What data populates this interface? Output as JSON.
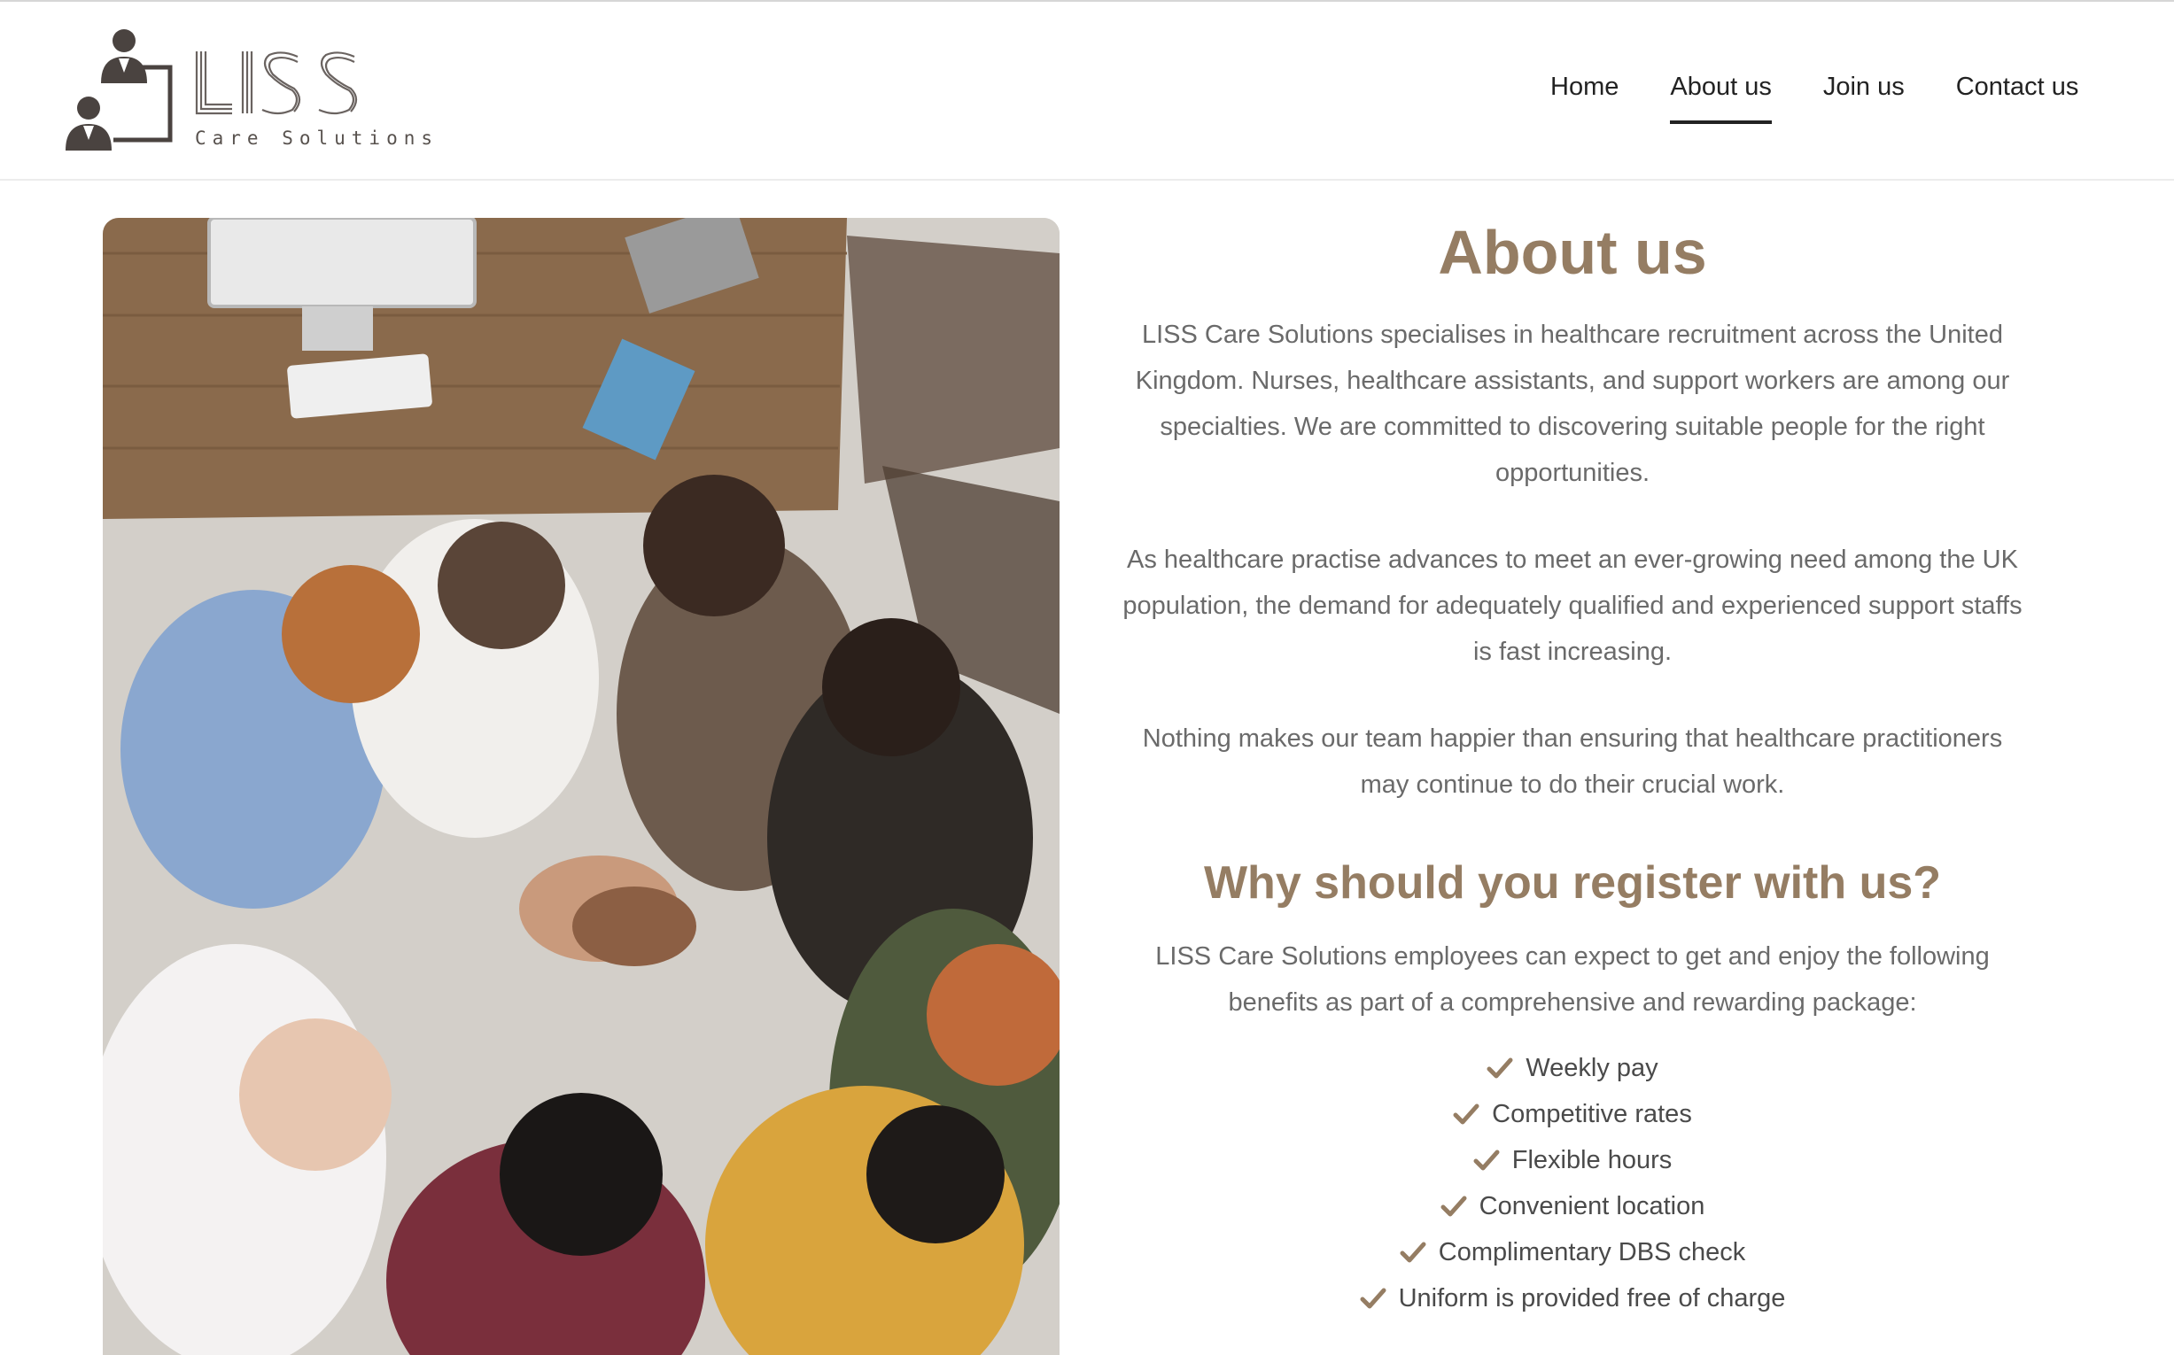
{
  "brand": {
    "name": "LISS",
    "tagline": "Care Solutions",
    "accent_color": "#957d63"
  },
  "nav": {
    "items": [
      {
        "label": "Home",
        "active": false
      },
      {
        "label": "About us",
        "active": true
      },
      {
        "label": "Join us",
        "active": false
      },
      {
        "label": "Contact us",
        "active": false
      }
    ]
  },
  "hero_image": {
    "icon": "team-hands-together-photo"
  },
  "about": {
    "title": "About us",
    "paragraphs": [
      "LISS Care Solutions specialises in healthcare recruitment across the United Kingdom. Nurses, healthcare assistants, and support workers are among our specialties. We are committed to discovering suitable people for the right opportunities.",
      "As healthcare practise advances to meet an ever-growing need among the UK population, the demand for adequately qualified and experienced support staffs is fast increasing.",
      "Nothing makes our team happier than ensuring that healthcare practitioners may continue to do their crucial work."
    ]
  },
  "register": {
    "title": "Why should you register with us?",
    "intro": "LISS Care Solutions employees can expect to get and enjoy the following benefits as part of a comprehensive and rewarding package:",
    "benefit_icon": "check-icon",
    "benefits": [
      "Weekly pay",
      "Competitive rates",
      "Flexible hours",
      "Convenient location",
      "Complimentary DBS check",
      "Uniform is provided free of charge"
    ]
  }
}
